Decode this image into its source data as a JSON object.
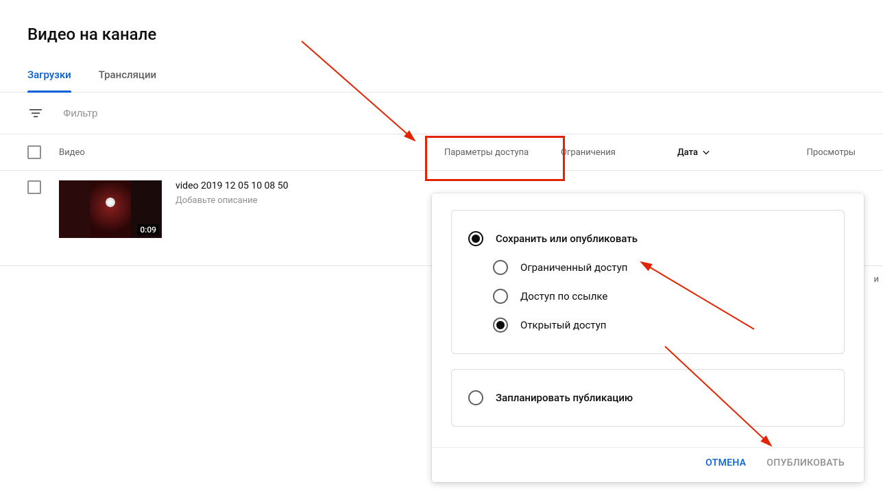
{
  "page": {
    "title": "Видео на канале"
  },
  "tabs": {
    "uploads": "Загрузки",
    "live": "Трансляции"
  },
  "filter": {
    "placeholder": "Фильтр"
  },
  "table": {
    "headers": {
      "video": "Видео",
      "visibility": "Параметры доступа",
      "restrictions": "Ограничения",
      "date": "Дата",
      "views": "Просмотры"
    }
  },
  "videos": [
    {
      "title": "video 2019 12 05 10 08 50",
      "description_placeholder": "Добавьте описание",
      "duration": "0:09"
    }
  ],
  "visibility_popover": {
    "main_option": "Сохранить или опубликовать",
    "sub_options": {
      "private": "Ограниченный доступ",
      "unlisted": "Доступ по ссылке",
      "public": "Открытый доступ"
    },
    "schedule_option": "Запланировать публикацию",
    "cancel": "ОТМЕНА",
    "publish": "ОПУБЛИКОВАТЬ"
  },
  "misc": {
    "trailing_letter": "и"
  }
}
